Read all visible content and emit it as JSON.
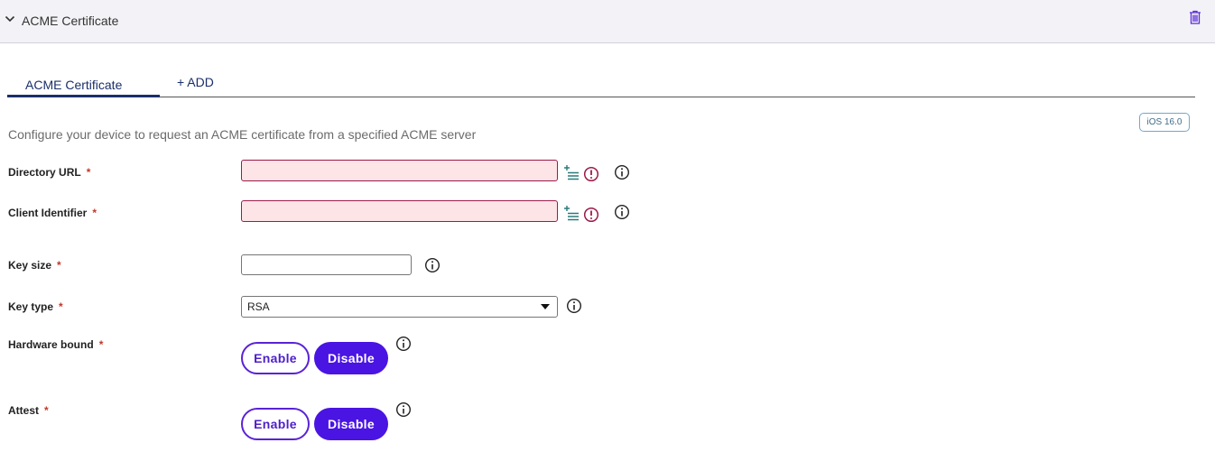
{
  "header": {
    "title": "ACME Certificate"
  },
  "tabs": {
    "active_label": "ACME Certificate",
    "add_label": "+ ADD"
  },
  "badge": "iOS 16.0",
  "description": "Configure your device to request an ACME certificate from a specified ACME server",
  "fields": {
    "directory_url": {
      "label": "Directory URL",
      "required": "*",
      "value": ""
    },
    "client_identifier": {
      "label": "Client Identifier",
      "required": "*",
      "value": ""
    },
    "key_size": {
      "label": "Key size",
      "required": "*",
      "value": ""
    },
    "key_type": {
      "label": "Key type",
      "required": "*",
      "value": "RSA"
    },
    "hardware_bound": {
      "label": "Hardware bound",
      "required": "*",
      "enable": "Enable",
      "disable": "Disable",
      "selected": "Disable"
    },
    "attest": {
      "label": "Attest",
      "required": "*",
      "enable": "Enable",
      "disable": "Disable",
      "selected": "Disable"
    }
  },
  "colors": {
    "accent": "#4a14e3",
    "error_border": "#9b1b4a",
    "error_fill": "#fde4e6",
    "tab_active": "#1b2f6b"
  },
  "icons": [
    "chevron-down-icon",
    "trash-icon",
    "variable-list-icon",
    "error-icon",
    "info-icon",
    "dropdown-caret-icon"
  ]
}
